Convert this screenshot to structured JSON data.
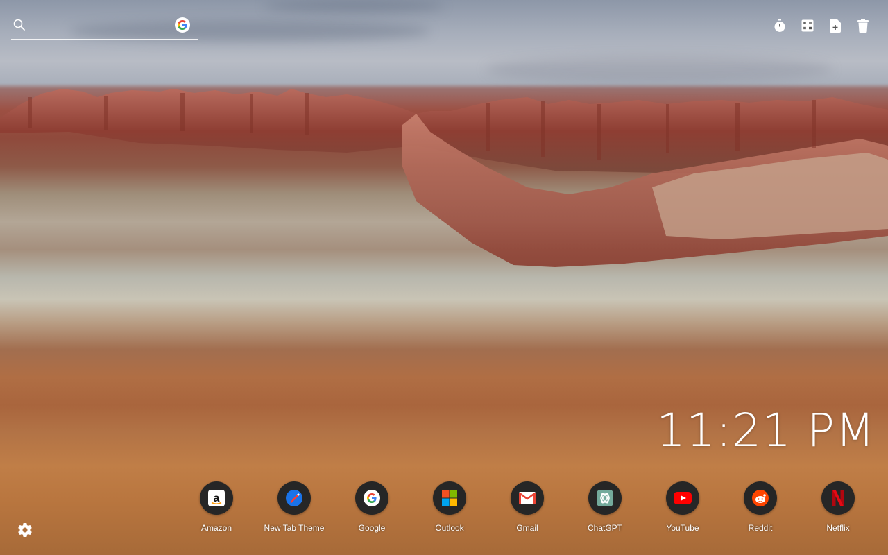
{
  "search": {
    "placeholder": "",
    "icon": "search-icon",
    "engine_icon": "google-icon"
  },
  "tools": [
    {
      "name": "timer-icon"
    },
    {
      "name": "calculator-icon"
    },
    {
      "name": "add-note-icon"
    },
    {
      "name": "trash-icon"
    }
  ],
  "clock": {
    "time": "11:21 PM"
  },
  "shortcuts": [
    {
      "label": "Amazon",
      "icon": "amazon-icon",
      "color": "#ffffff"
    },
    {
      "label": "New Tab Theme",
      "icon": "new-tab-theme-icon",
      "color": "#1a73e8"
    },
    {
      "label": "Google",
      "icon": "google-icon",
      "color": "#ffffff"
    },
    {
      "label": "Outlook",
      "icon": "outlook-icon",
      "color": "#f25022"
    },
    {
      "label": "Gmail",
      "icon": "gmail-icon",
      "color": "#ea4335"
    },
    {
      "label": "ChatGPT",
      "icon": "chatgpt-icon",
      "color": "#74aa9c"
    },
    {
      "label": "YouTube",
      "icon": "youtube-icon",
      "color": "#ff0000"
    },
    {
      "label": "Reddit",
      "icon": "reddit-icon",
      "color": "#ff4500"
    },
    {
      "label": "Netflix",
      "icon": "netflix-icon",
      "color": "#e50914"
    }
  ],
  "settings": {
    "icon": "gear-icon"
  }
}
